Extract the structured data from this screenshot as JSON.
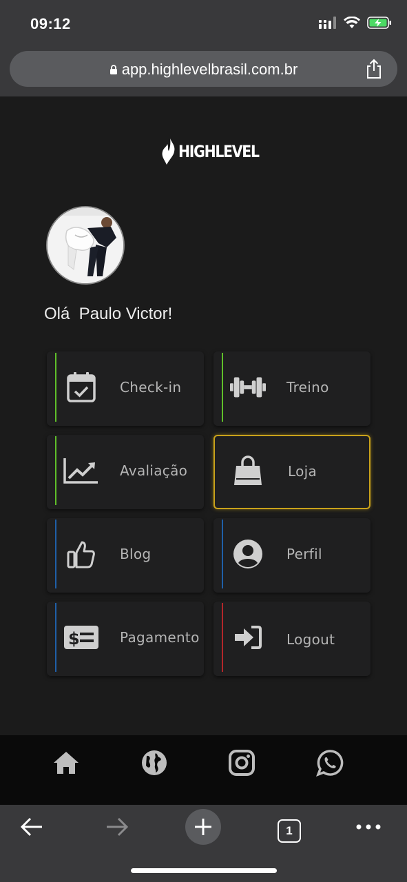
{
  "status": {
    "time": "09:12"
  },
  "browser": {
    "url": "app.highlevelbrasil.com.br",
    "tab_count": "1"
  },
  "brand": {
    "logo_text": "HIGHLEVEL"
  },
  "greeting": "Olá  Paulo Victor!",
  "menu": [
    {
      "label": "Check-in",
      "icon": "calendar-check-icon",
      "accent": "#5fbf2a"
    },
    {
      "label": "Treino",
      "icon": "dumbbell-icon",
      "accent": "#5fbf2a"
    },
    {
      "label": "Avaliação",
      "icon": "chart-line-icon",
      "accent": "#5fbf2a"
    },
    {
      "label": "Loja",
      "icon": "shopping-bag-icon",
      "accent": "#c9a21a",
      "active": true
    },
    {
      "label": "Blog",
      "icon": "thumbs-up-icon",
      "accent": "#1f5fa8"
    },
    {
      "label": "Perfil",
      "icon": "user-circle-icon",
      "accent": "#1f5fa8"
    },
    {
      "label": "Pagamento",
      "icon": "money-bill-icon",
      "accent": "#1f5fa8"
    },
    {
      "label": "Logout",
      "icon": "sign-in-icon",
      "accent": "#b3262a"
    }
  ],
  "bottom_nav": [
    "home-icon",
    "globe-icon",
    "instagram-icon",
    "whatsapp-icon"
  ],
  "colors": {
    "accent_green": "#5fbf2a",
    "accent_blue": "#1f5fa8",
    "accent_red": "#b3262a",
    "active_gold": "#c9a21a"
  }
}
